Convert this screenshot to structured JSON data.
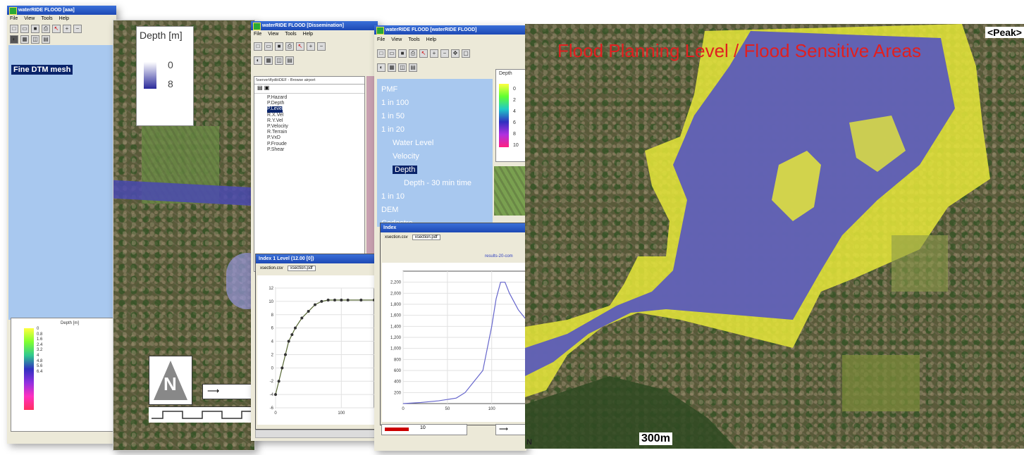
{
  "win1": {
    "title": "waterRIDE FLOOD [aaa]",
    "menu": [
      "File",
      "View",
      "Tools",
      "Help"
    ],
    "layer": "Fine DTM mesh",
    "legend_title": "Depth [m]",
    "legend_values": [
      "0",
      "0.8",
      "1.6",
      "2.4",
      "3.2",
      "4",
      "4.8",
      "5.6",
      "6.4"
    ]
  },
  "win2": {
    "legend_title": "Depth [m]",
    "legend_values": [
      "0",
      "8"
    ],
    "north": "N"
  },
  "win3": {
    "title": "waterRIDE FLOOD [Dissemination]",
    "menu": [
      "File",
      "View",
      "Tools",
      "Help"
    ],
    "path": "\\\\server\\flydb\\DEF - Browse airport",
    "tree": [
      "P.Hazard",
      "P.Depth",
      "P.Level",
      "R.X.Vel",
      "R.Y.Vel",
      "P.Velocity",
      "R.Terrain",
      "P.VxD",
      "P.Froude",
      "P.Shear"
    ],
    "tree_selected": "P.Level",
    "chart_title": "Index 1 Level (12.00 [0])",
    "tabs": [
      "xsection.csv",
      "xsection.pdf"
    ]
  },
  "win4": {
    "title": "waterRIDE FLOOD [waterRIDE FLOOD]",
    "menu": [
      "File",
      "View",
      "Tools",
      "Help"
    ],
    "tree": [
      "PMF",
      "1 in 100",
      "1 in 50",
      "1 in 20",
      "Water Level",
      "Velocity",
      "Depth",
      "Depth - 30 min time",
      "1 in 10",
      "DEM",
      "Cadastre"
    ],
    "tree_selected": "Depth",
    "legend_title": "Depth",
    "legend_values": [
      "0",
      "2",
      "4",
      "6",
      "8",
      "10"
    ],
    "chart_title": "Index",
    "tabs": [
      "xsection.csv",
      "xsection.pdf"
    ],
    "result_label": "results-20-com",
    "speed_value": "10"
  },
  "map": {
    "title": "Flood Planning Level / Flood Sensitive Areas",
    "peak": "<Peak>",
    "scale": "300m",
    "north": "N"
  },
  "chart_data": [
    {
      "type": "line",
      "title": "",
      "x": [
        0,
        5,
        10,
        15,
        20,
        25,
        30,
        40,
        50,
        60,
        70,
        80,
        90,
        100,
        110,
        130,
        150
      ],
      "values": [
        -4,
        -2,
        0,
        2,
        4,
        5,
        6,
        7.5,
        8.5,
        9.5,
        10,
        10.2,
        10.2,
        10.2,
        10.2,
        10.2,
        10.2
      ],
      "xlim": [
        0,
        150
      ],
      "ylim": [
        -6,
        12
      ],
      "xticks": [
        "0",
        "100"
      ],
      "yticks": [
        "12",
        "10",
        "8",
        "6",
        "4",
        "2",
        "0",
        "-2",
        "-4",
        "-6"
      ]
    },
    {
      "type": "line",
      "title": "",
      "x": [
        0,
        20,
        40,
        60,
        70,
        80,
        90,
        100,
        105,
        110,
        115,
        120,
        130,
        140
      ],
      "values": [
        0,
        20,
        50,
        100,
        200,
        400,
        600,
        1400,
        1900,
        2200,
        2200,
        2000,
        1700,
        1500
      ],
      "xlim": [
        0,
        140
      ],
      "ylim": [
        0,
        2400
      ],
      "xticks": [
        "0",
        "50",
        "100"
      ],
      "yticks": [
        "2,200",
        "2,000",
        "1,800",
        "1,600",
        "1,400",
        "1,200",
        "1,000",
        "800",
        "600",
        "400",
        "200"
      ]
    }
  ]
}
